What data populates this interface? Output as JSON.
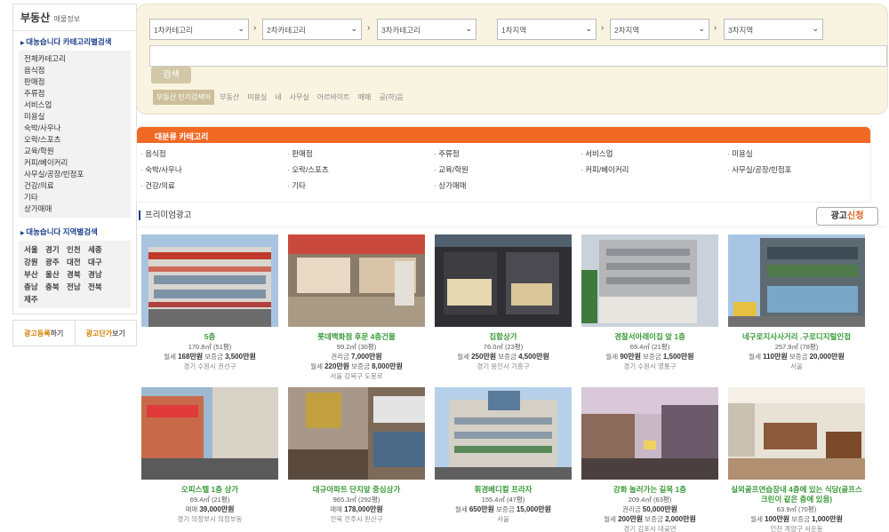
{
  "sidebar": {
    "title": "부동산",
    "subtitle": "매물정보",
    "category_section_title": "대농습니다 카테고리별검색",
    "categories": [
      "전체카테고리",
      "음식점",
      "판매점",
      "주류점",
      "서비스업",
      "미용실",
      "숙박/사우나",
      "오락/스포츠",
      "교육/학원",
      "커피/베이커리",
      "사무실/공장/빈점포",
      "건강/의료",
      "기타",
      "상가매매"
    ],
    "region_section_title": "대농습니다 지역별검색",
    "regions": [
      "서울",
      "경기",
      "인천",
      "세종",
      "강원",
      "광주",
      "대전",
      "대구",
      "부산",
      "울산",
      "경북",
      "경남",
      "충남",
      "충북",
      "전남",
      "전북",
      "제주"
    ],
    "btn_register_prefix": "광고등록",
    "btn_register_suffix": "하기",
    "btn_price_prefix": "광고단가",
    "btn_price_suffix": "보기"
  },
  "search": {
    "selects": [
      "1차카테고리",
      "2차카테고리",
      "3차카테고리",
      "1차지역",
      "2차지역",
      "3차지역"
    ],
    "button": "검색",
    "popular_label": "부동산 인기검색어",
    "popular_keywords": [
      "부동산",
      "미용실",
      "네",
      "사무실",
      "아르바이트",
      "매매",
      "공(하)음"
    ]
  },
  "categories_box": {
    "title": "대분류 카테고리",
    "items": [
      "음식점",
      "판매점",
      "주류점",
      "서비스업",
      "미용실",
      "숙박/사우나",
      "오락/스포츠",
      "교육/학원",
      "커피/베이커리",
      "사무실/공장/빈점포",
      "건강/의료",
      "기타",
      "상가매매"
    ]
  },
  "premium": {
    "title": "프리미엄광고",
    "ad_button_prefix": "광고",
    "ad_button_accent": "신청",
    "listings": [
      {
        "title": "5층",
        "area": "170.8㎡ (51평)",
        "price_label": "월세",
        "price": "168만원",
        "deposit_label": "보증금",
        "deposit": "3,500만원",
        "location": "경기 수원시 권선구"
      },
      {
        "title": "롯데백화점 후문 4층건물",
        "area": "99.2㎡ (30평)",
        "price_label": "권리금",
        "price": "7,000만원",
        "price2_label": "월세",
        "price2": "220만원",
        "deposit_label": "보증금",
        "deposit": "8,000만원",
        "location": "서울 강북구 도봉로"
      },
      {
        "title": "집합상가",
        "area": "76.0㎡ (23평)",
        "price_label": "월세",
        "price": "250만원",
        "deposit_label": "보증금",
        "deposit": "4,500만원",
        "location": "경기 용인시 기흥구"
      },
      {
        "title": "경찰서아래이집 앞 1층",
        "area": "69.4㎡ (21평)",
        "price_label": "월세",
        "price": "90만원",
        "deposit_label": "보증금",
        "deposit": "1,500만원",
        "location": "경기 수원시 영통구"
      },
      {
        "title": "네구로지사사거리 .구로디지털인접",
        "area": "257.9㎡ (78평)",
        "price_label": "월세",
        "price": "110만원",
        "deposit_label": "보증금",
        "deposit": "20,000만원",
        "location": "서울"
      },
      {
        "title": "오피스텔 1층 상가",
        "area": "69.4㎡ (21평)",
        "price_label": "매매",
        "price": "39,000만원",
        "location": "경기 의정부시 의정부동"
      },
      {
        "title": "대규아파트 단지앞 중심상가",
        "area": "965.3㎡ (292평)",
        "price_label": "매매",
        "price": "178,000만원",
        "location": "전북 전주시 완산구"
      },
      {
        "title": "휘경베디컬 프라자",
        "area": "155.4㎡ (47평)",
        "price_label": "월세",
        "price": "650만원",
        "deposit_label": "보증금",
        "deposit": "15,000만원",
        "location": "서울"
      },
      {
        "title": "강화 놀러가는 길목 1층",
        "area": "209.4㎡ (63평)",
        "price_label": "권리금",
        "price": "50,000만원",
        "price2_label": "월세",
        "price2": "200만원",
        "deposit_label": "보증금",
        "deposit": "2,000만원",
        "location": "경기 김포시 대곶면"
      },
      {
        "title": "실외골프연습장내 4층에 있는 식당(골프스크린이 같은 층에 있음)",
        "area": "63.9㎡ (70평)",
        "price_label": "월세",
        "price": "100만원",
        "deposit_label": "보증금",
        "deposit": "1,000만원",
        "location": "인천 계양구 서운동"
      }
    ]
  },
  "colors": {
    "accent_orange": "#f06a26",
    "title_green": "#3a9a3a",
    "nav_blue": "#1a3f8a",
    "panel_beige": "#f9f3e1"
  }
}
